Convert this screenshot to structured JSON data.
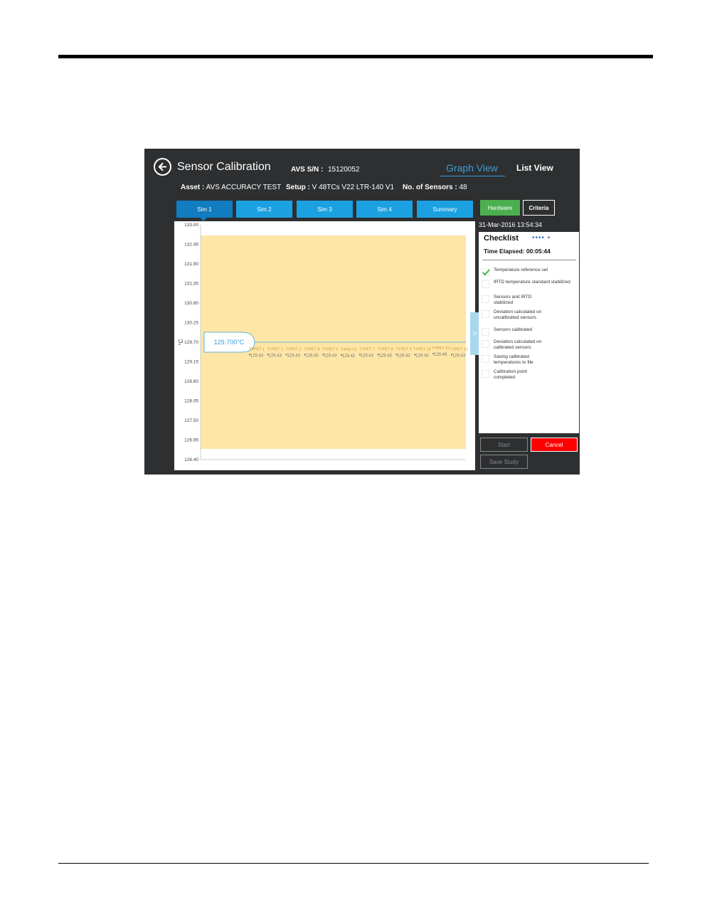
{
  "header": {
    "title": "Sensor Calibration",
    "sn_label": "AVS S/N :",
    "sn_value": "15120052",
    "graph_view": "Graph View",
    "list_view": "List View"
  },
  "info": {
    "asset_label": "Asset :",
    "asset_value": "AVS ACCURACY TEST",
    "setup_label": "Setup :",
    "setup_value": "V 48TCs V22 LTR-140 V1",
    "sensors_label": "No. of Sensors :",
    "sensors_value": "48"
  },
  "tabs": [
    "Sim 1",
    "Sim 2",
    "Sim 3",
    "Sim 4",
    "Summary"
  ],
  "buttons": {
    "hardware": "Hardware",
    "criteria": "Criteria",
    "start": "Start",
    "cancel": "Cancel",
    "save_study": "Save Study",
    "expand": ">"
  },
  "colors": {
    "background": "#2d2f31",
    "tab": "#1ba1e2",
    "tab_active": "#117cc0",
    "accent": "#3a9fdb",
    "band": "#fde6a6",
    "hardware": "#4caf4f",
    "cancel": "#ff0000"
  },
  "checklist": {
    "date": "31-Mar-2016 13:54:34",
    "title": "Checklist",
    "dots": "••••   •",
    "elapsed": "Time Elapsed: 00:05:44",
    "items": [
      {
        "label": "Temperature reference set",
        "checked": true
      },
      {
        "label": "IRTD temperature standard stabilized",
        "checked": false
      },
      {
        "label": "Sensors and IRTD stabilized",
        "checked": false
      },
      {
        "label": "Deviation calculated on uncalibrated sensors",
        "checked": false
      },
      {
        "label": "Sensors calibrated",
        "checked": false
      },
      {
        "label": "Deviation calculated on calibrated sensors",
        "checked": false
      },
      {
        "label": "Saving calibrated temperatures to file",
        "checked": false
      },
      {
        "label": "Calibration point completed",
        "checked": false
      }
    ]
  },
  "icons": {
    "back": "back-arrow-icon",
    "check": "checkmark-icon"
  },
  "chart_data": {
    "type": "scatter",
    "ylabel": "°C",
    "ylim": [
      126.4,
      133.0
    ],
    "yticks": [
      "133.00",
      "132.45",
      "131.90",
      "131.35",
      "130.80",
      "130.25",
      "129.70",
      "129.15",
      "128.60",
      "128.05",
      "127.50",
      "126.95",
      "126.40"
    ],
    "band": [
      126.7,
      132.7
    ],
    "setpoint": 129.7,
    "setpoint_label": "129.700°C",
    "series": [
      {
        "name": "TYPET 1",
        "value": 129.43,
        "label": "129.43"
      },
      {
        "name": "TYPET 2",
        "value": 129.43,
        "label": "129.43"
      },
      {
        "name": "TYPET 3",
        "value": 129.43,
        "label": "129.43"
      },
      {
        "name": "TYPET 4",
        "value": 129.43,
        "label": "129.43"
      },
      {
        "name": "TYPET 5",
        "value": 129.43,
        "label": "129.43"
      },
      {
        "name": "TYPET 6",
        "value": 129.42,
        "label": "129.42"
      },
      {
        "name": "TYPET 7",
        "value": 129.43,
        "label": "129.43"
      },
      {
        "name": "TYPET 8",
        "value": 129.43,
        "label": "129.43"
      },
      {
        "name": "TYPET 9",
        "value": 129.43,
        "label": "129.43"
      },
      {
        "name": "TYPET 10",
        "value": 129.43,
        "label": "129.43"
      },
      {
        "name": "TYPET 11",
        "value": 129.46,
        "label": "129.46"
      },
      {
        "name": "TYPET 12",
        "value": 129.43,
        "label": "129.43"
      }
    ]
  }
}
